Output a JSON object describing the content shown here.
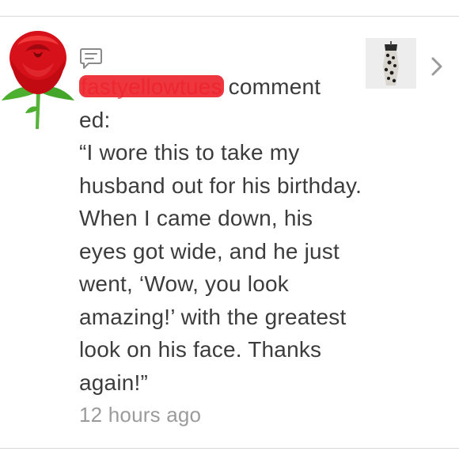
{
  "notification": {
    "icon": "comment-icon",
    "avatar_icon": "rose-icon",
    "username": "fastyellowtues",
    "action_part1": "comment",
    "action_part2": "ed:",
    "quote": "“I wore this to take my husband out for his birthday. When I came down, his eyes got wide, and he just went, ‘Wow, you look amazing!’ with the greatest look on his face. Thanks again!”",
    "timestamp": "12 hours ago",
    "thumbnail": "product-thumbnail",
    "chevron_icon": "chevron-right-icon"
  },
  "colors": {
    "text": "#3c3c3c",
    "muted": "#9b9b9b",
    "redaction": "#ec1a24",
    "divider": "#d9d9d9"
  }
}
